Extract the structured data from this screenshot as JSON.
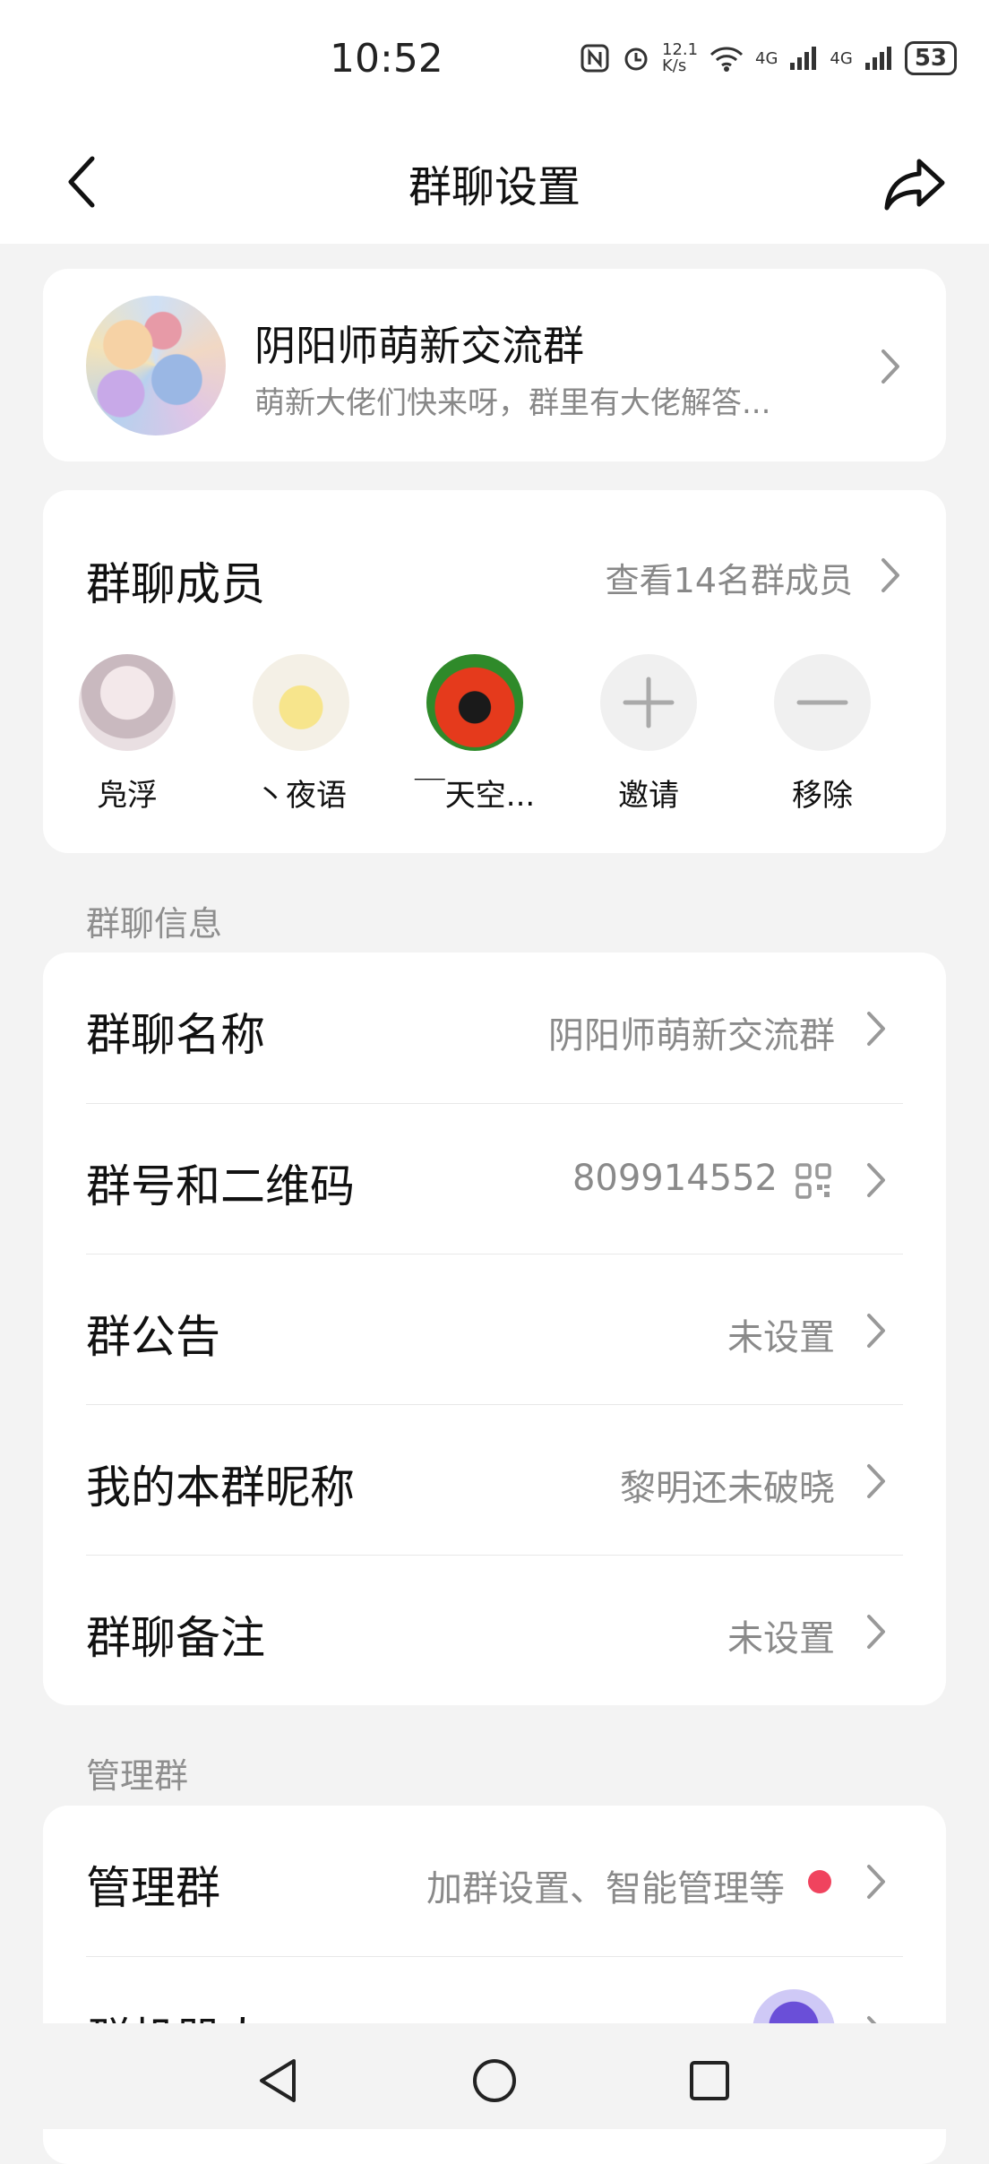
{
  "status_bar": {
    "time": "10:52",
    "net_speed": "12.1 K/s",
    "signal_1": "4G",
    "signal_2": "4G",
    "battery": "53"
  },
  "nav": {
    "title": "群聊设置",
    "back_icon": "chevron-left-icon",
    "share_icon": "share-icon"
  },
  "group": {
    "name": "阴阳师萌新交流群",
    "description": "萌新大佬们快来呀，群里有大佬解答..."
  },
  "members": {
    "title": "群聊成员",
    "view_all": "查看14名群成员",
    "list": [
      {
        "name": "凫浮"
      },
      {
        "name": "丶夜语"
      },
      {
        "name": "￣天空..."
      }
    ],
    "invite_label": "邀请",
    "remove_label": "移除"
  },
  "info_section": {
    "label": "群聊信息",
    "rows": [
      {
        "title": "群聊名称",
        "value": "阴阳师萌新交流群"
      },
      {
        "title": "群号和二维码",
        "value": "809914552"
      },
      {
        "title": "群公告",
        "value": "未设置"
      },
      {
        "title": "我的本群昵称",
        "value": "黎明还未破晓"
      },
      {
        "title": "群聊备注",
        "value": "未设置"
      }
    ]
  },
  "manage_section": {
    "label": "管理群",
    "rows": [
      {
        "title": "管理群",
        "value": "加群设置、智能管理等"
      },
      {
        "title": "群机器人",
        "value": ""
      }
    ]
  },
  "colors": {
    "accent_red": "#f0435e",
    "background": "#f3f3f3"
  }
}
